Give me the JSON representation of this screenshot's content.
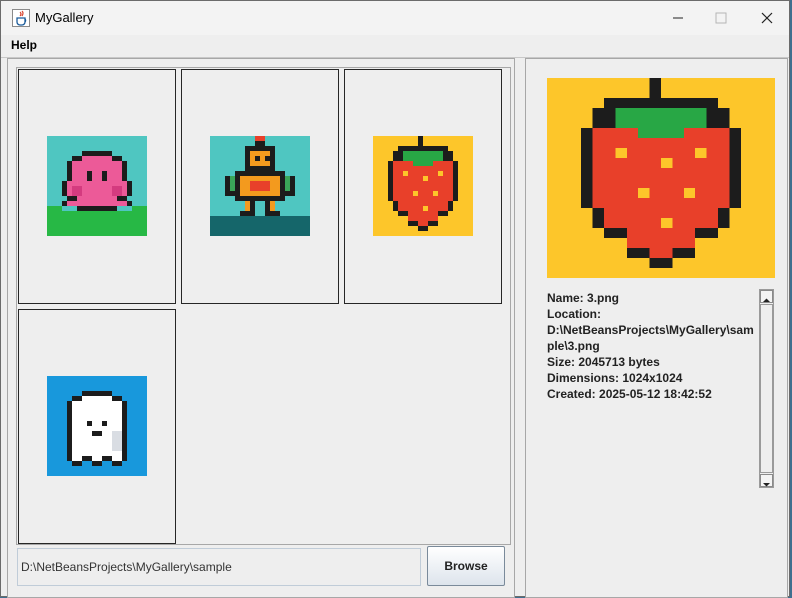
{
  "window": {
    "title": "MyGallery",
    "icon": "java-cup-icon",
    "controls": [
      "minimize-icon",
      "maximize-icon",
      "close-icon"
    ]
  },
  "menu": {
    "items": [
      {
        "label": "Help"
      }
    ]
  },
  "gallery": {
    "thumbnails": [
      {
        "subject": "pink blob creature on grass",
        "icon": "pink-creature-image",
        "background": "#4fc6c1"
      },
      {
        "subject": "orange robot",
        "icon": "robot-image",
        "background": "#4fc6c1"
      },
      {
        "subject": "strawberry",
        "icon": "strawberry-image",
        "background": "#fdc62a"
      },
      {
        "subject": "white ghost",
        "icon": "ghost-image",
        "background": "#1898dc"
      }
    ]
  },
  "path_field": {
    "value": "D:\\NetBeansProjects\\MyGallery\\sample"
  },
  "browse_button": {
    "label": "Browse"
  },
  "preview": {
    "image": "strawberry-image",
    "info_lines": [
      "Name: 3.png",
      "Location:",
      "D:\\NetBeansProjects\\MyGallery\\sample\\3.png",
      "Size: 2045713 bytes",
      "Dimensions: 1024x1024",
      "Created: 2025-05-12 18:42:52"
    ]
  },
  "colors": {
    "window_bg": "#eeeeee",
    "thumb_border": "#262626",
    "teal": "#4fc6c1",
    "yellow": "#fdc62a",
    "blue": "#1898dc"
  }
}
